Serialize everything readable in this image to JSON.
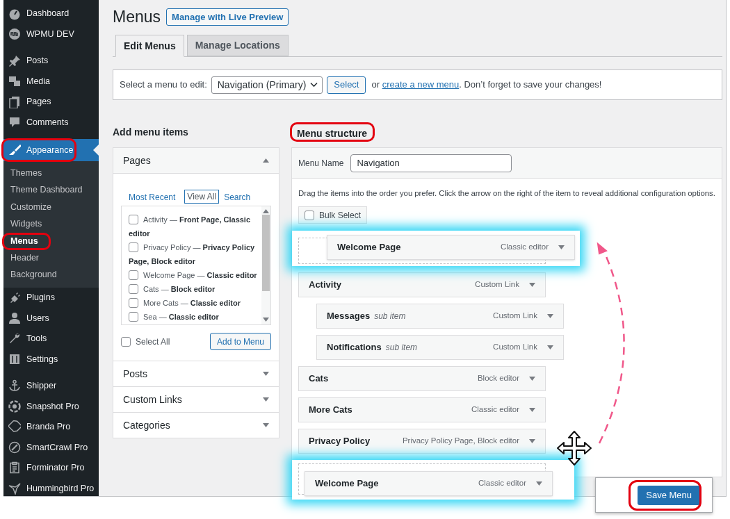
{
  "sidebar": {
    "groups": [
      {
        "items": [
          {
            "label": "Dashboard",
            "selected": false,
            "highlighted": false
          },
          {
            "label": "WPMU DEV",
            "selected": false,
            "highlighted": false
          }
        ]
      },
      {
        "items": [
          {
            "label": "Posts",
            "selected": false,
            "highlighted": false
          },
          {
            "label": "Media",
            "selected": false,
            "highlighted": false
          },
          {
            "label": "Pages",
            "selected": false,
            "highlighted": false
          },
          {
            "label": "Comments",
            "selected": false,
            "highlighted": false
          }
        ]
      },
      {
        "items": [
          {
            "label": "Appearance",
            "selected": true,
            "highlighted": true,
            "children": [
              {
                "label": "Themes",
                "selected": false,
                "highlighted": false
              },
              {
                "label": "Theme Dashboard",
                "selected": false,
                "highlighted": false
              },
              {
                "label": "Customize",
                "selected": false,
                "highlighted": false
              },
              {
                "label": "Widgets",
                "selected": false,
                "highlighted": false
              },
              {
                "label": "Menus",
                "selected": true,
                "highlighted": true
              },
              {
                "label": "Header",
                "selected": false,
                "highlighted": false
              },
              {
                "label": "Background",
                "selected": false,
                "highlighted": false
              }
            ]
          },
          {
            "label": "Plugins",
            "selected": false,
            "highlighted": false
          },
          {
            "label": "Users",
            "selected": false,
            "highlighted": false
          },
          {
            "label": "Tools",
            "selected": false,
            "highlighted": false
          },
          {
            "label": "Settings",
            "selected": false,
            "highlighted": false
          }
        ]
      },
      {
        "items": [
          {
            "label": "Shipper",
            "selected": false,
            "highlighted": false
          },
          {
            "label": "Snapshot Pro",
            "selected": false,
            "highlighted": false
          },
          {
            "label": "Branda Pro",
            "selected": false,
            "highlighted": false
          },
          {
            "label": "SmartCrawl Pro",
            "selected": false,
            "highlighted": false
          },
          {
            "label": "Forminator Pro",
            "selected": false,
            "highlighted": false
          },
          {
            "label": "Hummingbird Pro",
            "selected": false,
            "highlighted": false
          }
        ]
      }
    ]
  },
  "page": {
    "title": "Menus",
    "live_preview_button": "Manage with Live Preview"
  },
  "tabs": [
    {
      "label": "Edit Menus",
      "selected": true
    },
    {
      "label": "Manage Locations",
      "selected": false
    }
  ],
  "menu_select": {
    "label": "Select a menu to edit:",
    "value": "Navigation (Primary)",
    "button": "Select",
    "note_before": "or",
    "link": "create a new menu",
    "note_after": ". Don’t forget to save your changes!"
  },
  "add_items": {
    "heading": "Add menu items",
    "sections": [
      {
        "title": "Pages",
        "expanded": true,
        "tabs": [
          {
            "label": "Most Recent",
            "selected": false
          },
          {
            "label": "View All",
            "selected": true
          },
          {
            "label": "Search",
            "selected": false
          }
        ],
        "pages": [
          {
            "label": "Activity — **Front Page, Classic editor**",
            "checked": false
          },
          {
            "label": "Privacy Policy — **Privacy Policy Page, Block editor**",
            "checked": false
          },
          {
            "label": "Welcome Page — **Classic editor**",
            "checked": false
          },
          {
            "label": "Cats — **Block editor**",
            "checked": false
          },
          {
            "label": "More Cats — **Classic editor**",
            "checked": false
          },
          {
            "label": "Sea — **Classic editor**",
            "checked": false
          }
        ],
        "select_all": {
          "label": "Select All",
          "checked": false
        },
        "button": "Add to Menu"
      },
      {
        "title": "Posts",
        "expanded": false
      },
      {
        "title": "Custom Links",
        "expanded": false
      },
      {
        "title": "Categories",
        "expanded": false
      }
    ]
  },
  "menu_structure": {
    "heading": "Menu structure",
    "highlighted": true,
    "name_label": "Menu Name",
    "name_value": "Navigation",
    "instructions": "Drag the items into the order you prefer. Click the arrow on the right of the item to reveal additional configuration options.",
    "bulk_select": {
      "label": "Bulk Select",
      "checked": false
    },
    "items": [
      {
        "kind": "drop-target",
        "title": "Welcome Page",
        "type": "Classic editor"
      },
      {
        "kind": "item",
        "title": "Activity",
        "type": "Custom Link",
        "children": [
          {
            "kind": "item",
            "title": "Messages",
            "note": "sub item",
            "type": "Custom Link"
          },
          {
            "kind": "item",
            "title": "Notifications",
            "note": "sub item",
            "type": "Custom Link"
          }
        ]
      },
      {
        "kind": "item",
        "title": "Cats",
        "type": "Block editor"
      },
      {
        "kind": "item",
        "title": "More Cats",
        "type": "Classic editor"
      },
      {
        "kind": "item",
        "title": "Privacy Policy",
        "type": "Privacy Policy Page, Block editor"
      },
      {
        "kind": "dragging",
        "title": "Welcome Page",
        "type": "Classic editor"
      }
    ]
  },
  "save": {
    "button": "Save Menu",
    "highlighted": true
  }
}
